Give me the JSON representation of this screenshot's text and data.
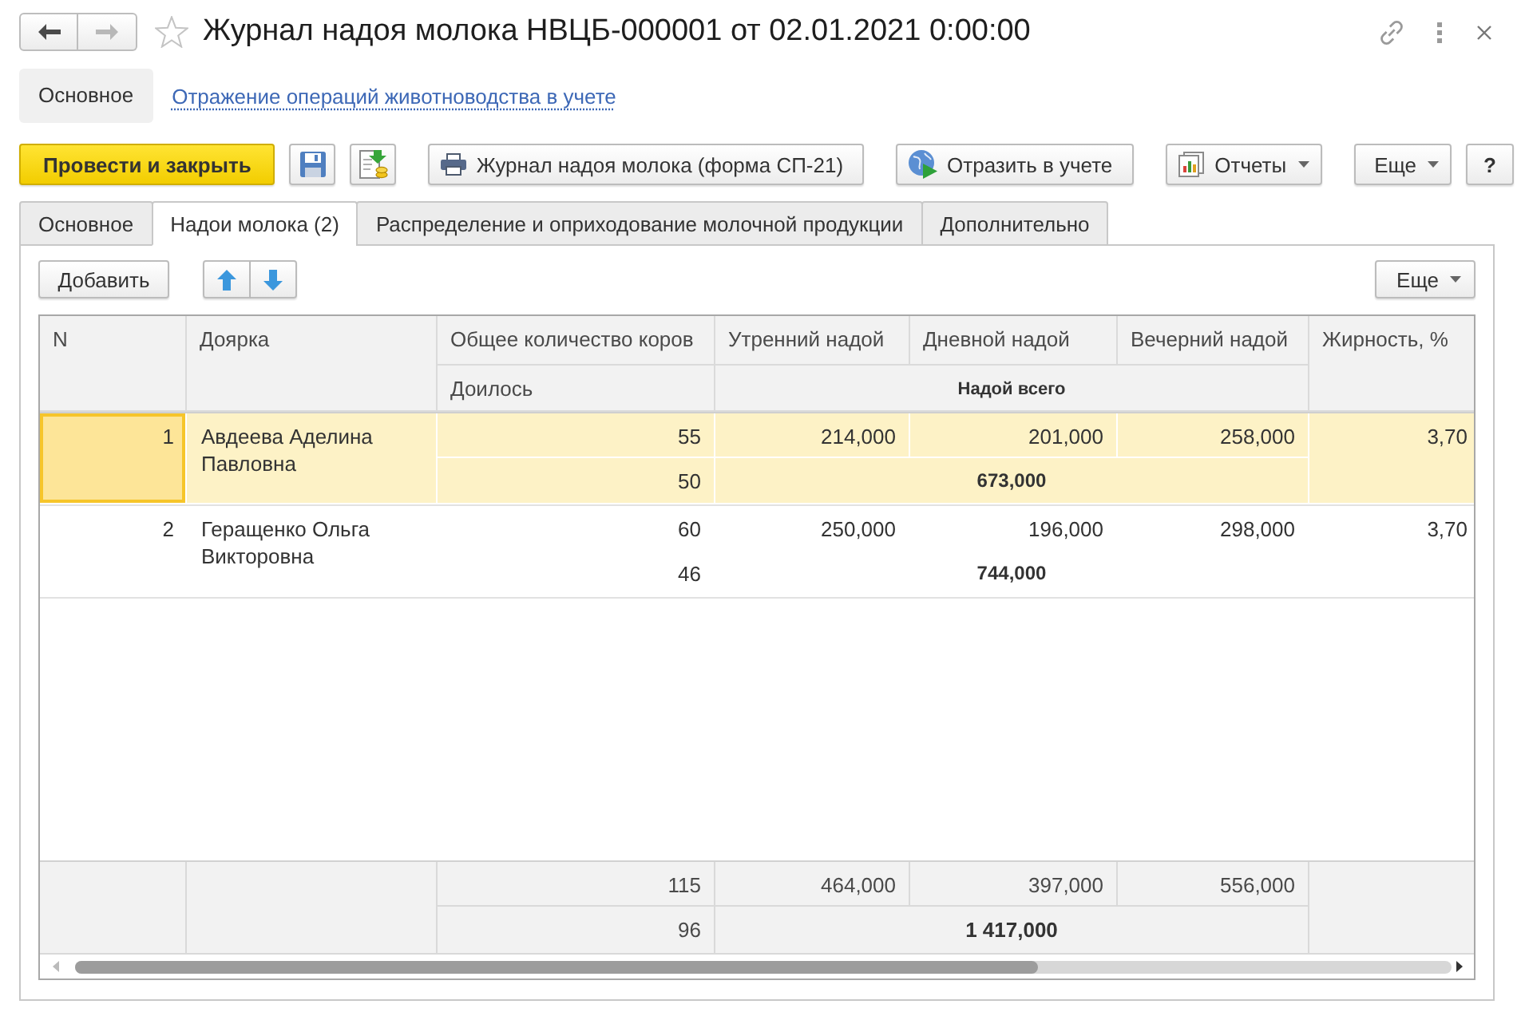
{
  "window": {
    "title": "Журнал надоя молока НВЦБ-000001 от 02.01.2021 0:00:00"
  },
  "navigation": [
    {
      "kind": "back",
      "disabled": false
    },
    {
      "kind": "forward",
      "disabled": true
    }
  ],
  "sections": [
    {
      "label": "Основное",
      "selected": true
    },
    {
      "label": "Отражение операций животноводства в учете",
      "selected": false
    }
  ],
  "toolbar": [
    {
      "kind": "primary",
      "label": "Провести и закрыть"
    },
    {
      "kind": "icon"
    },
    {
      "kind": "icon"
    },
    {
      "kind": "button",
      "label": "Журнал надоя молока (форма СП-21)"
    },
    {
      "kind": "button",
      "label": "Отразить в учете"
    },
    {
      "kind": "menu",
      "label": "Отчеты"
    },
    {
      "kind": "menu",
      "label": "Еще"
    },
    {
      "kind": "button",
      "label": "?"
    }
  ],
  "tabs": [
    {
      "label": "Основное",
      "selected": false
    },
    {
      "label": "Надои молока (2)",
      "selected": true
    },
    {
      "label": "Распределение и оприходование молочной продукции",
      "selected": false
    },
    {
      "label": "Дополнительно",
      "selected": false
    }
  ],
  "panel_toolbar": {
    "add_button": "Добавить",
    "more_menu": "Еще"
  },
  "table": {
    "columns": [
      {
        "label": "N"
      },
      {
        "label": "Доярка"
      },
      {
        "label": "Общее количество коров",
        "sublabel": "Доилось"
      },
      {
        "label": "Утренний надой"
      },
      {
        "label": "Дневной надой"
      },
      {
        "label": "Вечерний надой"
      },
      {
        "label": "Жирность, %"
      }
    ],
    "group_label": "Надой всего",
    "rows": [
      {
        "number": "1",
        "milkmaid": "Авдеева Аделина Павловна",
        "cows_total": "55",
        "cows_milked": "50",
        "morning": "214,000",
        "day": "201,000",
        "evening": "258,000",
        "total": "673,000",
        "fat": "3,70",
        "selected": true
      },
      {
        "number": "2",
        "milkmaid": "Геращенко Ольга Викторовна",
        "cows_total": "60",
        "cows_milked": "46",
        "morning": "250,000",
        "day": "196,000",
        "evening": "298,000",
        "total": "744,000",
        "fat": "3,70",
        "selected": false
      }
    ],
    "totals": {
      "cows_total": "115",
      "cows_milked": "96",
      "morning": "464,000",
      "day": "397,000",
      "evening": "556,000",
      "total": "1 417,000"
    }
  }
}
